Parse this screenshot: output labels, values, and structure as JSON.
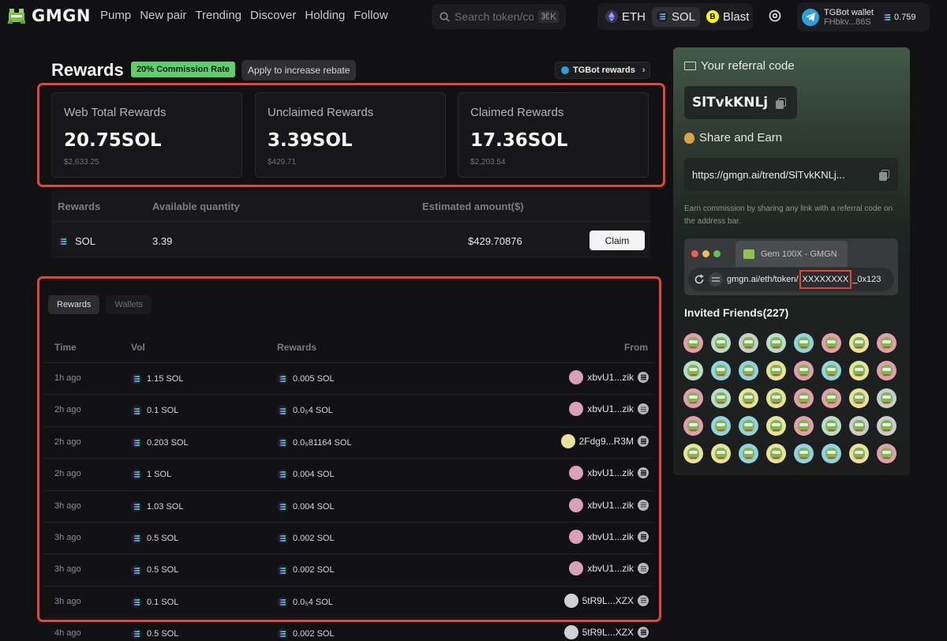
{
  "app": {
    "brand": "GMGN",
    "nav": [
      "Pump",
      "New pair",
      "Trending",
      "Discover",
      "Holding",
      "Follow"
    ],
    "search_placeholder": "Search token/cont",
    "search_shortcut": "⌘K",
    "chains": [
      {
        "label": "ETH",
        "active": false,
        "color": "#627eea"
      },
      {
        "label": "SOL",
        "active": true,
        "color": "#9945ff"
      },
      {
        "label": "Blast",
        "active": false,
        "color": "#fcfc03"
      }
    ],
    "wallet": {
      "title": "TGBot wallet",
      "address": "FHbkv...86S",
      "balance": "0.759"
    }
  },
  "rewards": {
    "title": "Rewards",
    "commission_badge": "20% Commission Rate",
    "apply_button": "Apply to increase rebate",
    "tgbot_button": "TGBot rewards",
    "cards": [
      {
        "label": "Web Total Rewards",
        "value": "20.75SOL",
        "usd": "$2,633.25"
      },
      {
        "label": "Unclaimed Rewards",
        "value": "3.39SOL",
        "usd": "$429.71"
      },
      {
        "label": "Claimed Rewards",
        "value": "17.36SOL",
        "usd": "$2,203.54"
      }
    ],
    "claim_table": {
      "headers": [
        "Rewards",
        "Available quantity",
        "Estimated amount($)"
      ],
      "row": {
        "token": "SOL",
        "quantity": "3.39",
        "amount": "$429.70876"
      },
      "claim_label": "Claim"
    }
  },
  "history": {
    "tabs": [
      {
        "label": "Rewards",
        "active": true
      },
      {
        "label": "Wallets",
        "active": false
      }
    ],
    "headers": [
      "Time",
      "Vol",
      "Rewards",
      "From"
    ],
    "rows": [
      {
        "time": "1h ago",
        "vol": "1.15 SOL",
        "reward": "0.005 SOL",
        "from": "xbvU1...zik",
        "avatar": "#d9a0b8"
      },
      {
        "time": "2h ago",
        "vol": "0.1 SOL",
        "reward": "0.0₅4 SOL",
        "from": "xbvU1...zik",
        "avatar": "#d9a0b8"
      },
      {
        "time": "2h ago",
        "vol": "0.203 SOL",
        "reward": "0.0₅81164 SOL",
        "from": "2Fdg9...R3M",
        "avatar": "#e8e29a"
      },
      {
        "time": "2h ago",
        "vol": "1 SOL",
        "reward": "0.004 SOL",
        "from": "xbvU1...zik",
        "avatar": "#d9a0b8"
      },
      {
        "time": "3h ago",
        "vol": "1.03 SOL",
        "reward": "0.004 SOL",
        "from": "xbvU1...zik",
        "avatar": "#d9a0b8"
      },
      {
        "time": "3h ago",
        "vol": "0.5 SOL",
        "reward": "0.002 SOL",
        "from": "xbvU1...zik",
        "avatar": "#d9a0b8"
      },
      {
        "time": "3h ago",
        "vol": "0.5 SOL",
        "reward": "0.002 SOL",
        "from": "xbvU1...zik",
        "avatar": "#d9a0b8"
      },
      {
        "time": "3h ago",
        "vol": "0.1 SOL",
        "reward": "0.0₅4 SOL",
        "from": "5tR9L...XZX",
        "avatar": "#cfd2d4"
      },
      {
        "time": "4h ago",
        "vol": "0.5 SOL",
        "reward": "0.002 SOL",
        "from": "5tR9L...XZX",
        "avatar": "#cfd2d4"
      }
    ]
  },
  "referral": {
    "title": "Your referral code",
    "code": "SlTvkKNLj",
    "share_title": "Share and Earn",
    "link": "https://gmgn.ai/trend/SlTvkKNLj...",
    "description": "Earn commission by sharing any link with a referral code on the address bar.",
    "browser_tab": "Gem 100X - GMGN",
    "url_prefix": "gmgn.ai/eth/token/",
    "url_code": "XXXXXXXX",
    "url_suffix": "_0x123",
    "friends_title": "Invited Friends(227)",
    "friend_avatar_colors": [
      "#e59bb0",
      "#b8dccd",
      "#c9ccd0",
      "#b8dccd",
      "#8fd3e6",
      "#e59bb0",
      "#e8e29a",
      "#e59bb0",
      "#b8dccd",
      "#8fd3e6",
      "#8fd3e6",
      "#e8e29a",
      "#e59bb0",
      "#8fd3e6",
      "#e8e29a",
      "#e59bb0",
      "#e59bb0",
      "#b8dccd",
      "#e8e29a",
      "#e8e29a",
      "#e59bb0",
      "#e59bb0",
      "#e8e29a",
      "#c9ccd0",
      "#e59bb0",
      "#8fd3e6",
      "#8fd3e6",
      "#e8e29a",
      "#e59bb0",
      "#b8dccd",
      "#c9ccd0",
      "#c9ccd0",
      "#e8e29a",
      "#e8e29a",
      "#8fd3e6",
      "#e8e29a",
      "#8fd3e6",
      "#8fd3e6",
      "#e8e29a",
      "#e59bb0"
    ]
  }
}
